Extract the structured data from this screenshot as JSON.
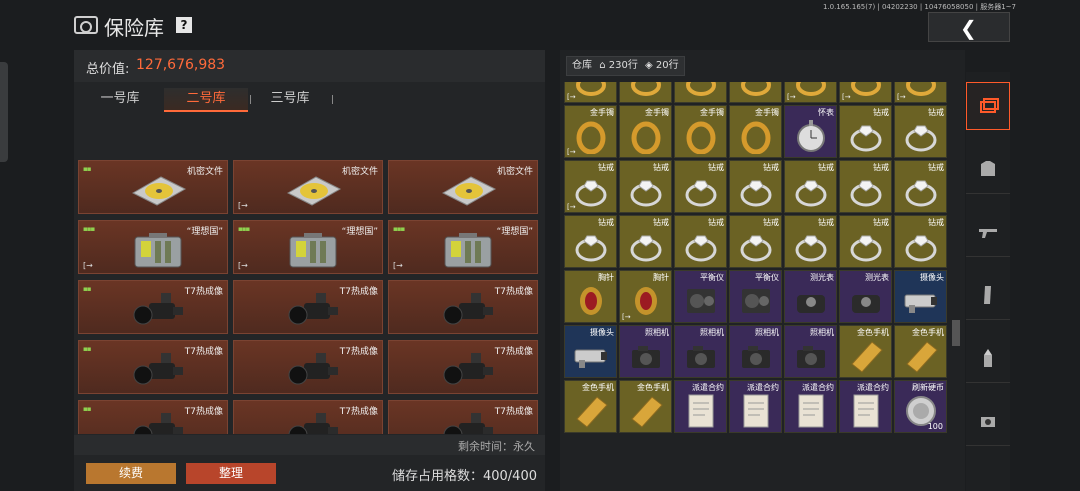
{
  "header": {
    "title": "保险库",
    "help": "?",
    "version": "1.0.165.165(7) | 04202230 | 10476058050 | 服务器1~7",
    "back_icon": "chevron-left-icon"
  },
  "left_panel": {
    "total_label": "总价值:",
    "total_value": "127,676,983",
    "tabs": [
      {
        "label": "一号库"
      },
      {
        "label": "二号库"
      },
      {
        "label": "三号库"
      }
    ],
    "active_tab": 1,
    "items": [
      {
        "name": "机密文件",
        "dots": "▪▪",
        "mark": "",
        "icon": "disc-icon"
      },
      {
        "name": "机密文件",
        "dots": "",
        "mark": "[→",
        "icon": "disc-icon"
      },
      {
        "name": "机密文件",
        "dots": "",
        "mark": "",
        "icon": "disc-icon"
      },
      {
        "name": "“理想国”",
        "dots": "▪▪▪",
        "mark": "[→",
        "icon": "case-icon"
      },
      {
        "name": "“理想国”",
        "dots": "▪▪▪",
        "mark": "[→",
        "icon": "case-icon"
      },
      {
        "name": "“理想国”",
        "dots": "▪▪▪",
        "mark": "[→",
        "icon": "case-icon"
      },
      {
        "name": "T7热成像",
        "dots": "▪▪",
        "mark": "",
        "icon": "thermal-scope-icon"
      },
      {
        "name": "T7热成像",
        "dots": "",
        "mark": "",
        "icon": "thermal-scope-icon"
      },
      {
        "name": "T7热成像",
        "dots": "",
        "mark": "",
        "icon": "thermal-scope-icon"
      },
      {
        "name": "T7热成像",
        "dots": "▪▪",
        "mark": "",
        "icon": "thermal-scope-icon"
      },
      {
        "name": "T7热成像",
        "dots": "",
        "mark": "",
        "icon": "thermal-scope-icon"
      },
      {
        "name": "T7热成像",
        "dots": "",
        "mark": "",
        "icon": "thermal-scope-icon"
      },
      {
        "name": "T7热成像",
        "dots": "▪▪",
        "mark": "",
        "icon": "thermal-scope-icon"
      },
      {
        "name": "T7热成像",
        "dots": "",
        "mark": "",
        "icon": "thermal-scope-icon"
      },
      {
        "name": "T7热成像",
        "dots": "",
        "mark": "",
        "icon": "thermal-scope-icon"
      }
    ],
    "remaining": "剩余时间：永久",
    "renew_button": "续费",
    "sort_button": "整理",
    "storage": "储存占用格数：400/400"
  },
  "right_panel": {
    "warehouse_label": "仓库",
    "count_a": "230行",
    "count_b": "20行",
    "items": [
      {
        "name": "",
        "rarity": "gold",
        "icon": "ring-icon",
        "mark": "[→"
      },
      {
        "name": "",
        "rarity": "gold",
        "icon": "ring-icon",
        "mark": ""
      },
      {
        "name": "",
        "rarity": "gold",
        "icon": "ring-icon",
        "mark": ""
      },
      {
        "name": "",
        "rarity": "gold",
        "icon": "ring-icon",
        "mark": ""
      },
      {
        "name": "",
        "rarity": "gold",
        "icon": "ring-icon",
        "mark": "[→"
      },
      {
        "name": "",
        "rarity": "gold",
        "icon": "ring-icon",
        "mark": "[→"
      },
      {
        "name": "",
        "rarity": "gold",
        "icon": "ring-icon",
        "mark": "[→"
      },
      {
        "name": "金手镯",
        "rarity": "gold",
        "icon": "bracelet-icon",
        "mark": "[→"
      },
      {
        "name": "金手镯",
        "rarity": "gold",
        "icon": "bracelet-icon",
        "mark": ""
      },
      {
        "name": "金手镯",
        "rarity": "gold",
        "icon": "bracelet-icon",
        "mark": ""
      },
      {
        "name": "金手镯",
        "rarity": "gold",
        "icon": "bracelet-icon",
        "mark": ""
      },
      {
        "name": "怀表",
        "rarity": "purple",
        "icon": "pocket-watch-icon",
        "mark": ""
      },
      {
        "name": "钻戒",
        "rarity": "gold",
        "icon": "diamond-ring-icon",
        "mark": ""
      },
      {
        "name": "钻戒",
        "rarity": "gold",
        "icon": "diamond-ring-icon",
        "mark": ""
      },
      {
        "name": "钻戒",
        "rarity": "gold",
        "icon": "diamond-ring-icon",
        "mark": "[→"
      },
      {
        "name": "钻戒",
        "rarity": "gold",
        "icon": "diamond-ring-icon",
        "mark": ""
      },
      {
        "name": "钻戒",
        "rarity": "gold",
        "icon": "diamond-ring-icon",
        "mark": ""
      },
      {
        "name": "钻戒",
        "rarity": "gold",
        "icon": "diamond-ring-icon",
        "mark": ""
      },
      {
        "name": "钻戒",
        "rarity": "gold",
        "icon": "diamond-ring-icon",
        "mark": ""
      },
      {
        "name": "钻戒",
        "rarity": "gold",
        "icon": "diamond-ring-icon",
        "mark": ""
      },
      {
        "name": "钻戒",
        "rarity": "gold",
        "icon": "diamond-ring-icon",
        "mark": ""
      },
      {
        "name": "钻戒",
        "rarity": "gold",
        "icon": "diamond-ring-icon",
        "mark": ""
      },
      {
        "name": "钻戒",
        "rarity": "gold",
        "icon": "diamond-ring-icon",
        "mark": ""
      },
      {
        "name": "钻戒",
        "rarity": "gold",
        "icon": "diamond-ring-icon",
        "mark": ""
      },
      {
        "name": "钻戒",
        "rarity": "gold",
        "icon": "diamond-ring-icon",
        "mark": ""
      },
      {
        "name": "钻戒",
        "rarity": "gold",
        "icon": "diamond-ring-icon",
        "mark": ""
      },
      {
        "name": "钻戒",
        "rarity": "gold",
        "icon": "diamond-ring-icon",
        "mark": ""
      },
      {
        "name": "钻戒",
        "rarity": "gold",
        "icon": "diamond-ring-icon",
        "mark": ""
      },
      {
        "name": "胸针",
        "rarity": "gold",
        "icon": "brooch-icon",
        "mark": ""
      },
      {
        "name": "胸针",
        "rarity": "gold",
        "icon": "brooch-icon",
        "mark": "[→"
      },
      {
        "name": "平衡仪",
        "rarity": "purple",
        "icon": "gyroscope-icon",
        "mark": ""
      },
      {
        "name": "平衡仪",
        "rarity": "purple",
        "icon": "gyroscope-icon",
        "mark": ""
      },
      {
        "name": "测光表",
        "rarity": "purple",
        "icon": "light-meter-icon",
        "mark": ""
      },
      {
        "name": "测光表",
        "rarity": "purple",
        "icon": "light-meter-icon",
        "mark": ""
      },
      {
        "name": "摄像头",
        "rarity": "blue",
        "icon": "camera-icon",
        "mark": ""
      },
      {
        "name": "摄像头",
        "rarity": "blue",
        "icon": "camera-icon",
        "mark": ""
      },
      {
        "name": "照相机",
        "rarity": "purple",
        "icon": "photo-camera-icon",
        "mark": ""
      },
      {
        "name": "照相机",
        "rarity": "purple",
        "icon": "photo-camera-icon",
        "mark": ""
      },
      {
        "name": "照相机",
        "rarity": "purple",
        "icon": "photo-camera-icon",
        "mark": ""
      },
      {
        "name": "照相机",
        "rarity": "purple",
        "icon": "photo-camera-icon",
        "mark": ""
      },
      {
        "name": "金色手机",
        "rarity": "gold",
        "icon": "gold-phone-icon",
        "mark": ""
      },
      {
        "name": "金色手机",
        "rarity": "gold",
        "icon": "gold-phone-icon",
        "mark": ""
      },
      {
        "name": "金色手机",
        "rarity": "gold",
        "icon": "gold-phone-icon",
        "mark": ""
      },
      {
        "name": "金色手机",
        "rarity": "gold",
        "icon": "gold-phone-icon",
        "mark": ""
      },
      {
        "name": "派遣合约",
        "rarity": "purple",
        "icon": "contract-icon",
        "mark": ""
      },
      {
        "name": "派遣合约",
        "rarity": "purple",
        "icon": "contract-icon",
        "mark": ""
      },
      {
        "name": "派遣合约",
        "rarity": "purple",
        "icon": "contract-icon",
        "mark": ""
      },
      {
        "name": "派遣合约",
        "rarity": "purple",
        "icon": "contract-icon",
        "mark": ""
      },
      {
        "name": "刷新硬币",
        "rarity": "purple",
        "icon": "coin-icon",
        "mark": "",
        "count": "100"
      }
    ]
  },
  "sidenav": [
    {
      "name": "all-items-icon"
    },
    {
      "name": "armor-icon"
    },
    {
      "name": "rifle-icon"
    },
    {
      "name": "magazine-icon"
    },
    {
      "name": "ammo-icon"
    },
    {
      "name": "scope-icon"
    }
  ],
  "colors": {
    "accent": "#ff6a3a",
    "gold": "#6b6224",
    "purple": "#3a2a58",
    "blue": "#1f3558",
    "left_cell": "#5e3023"
  }
}
